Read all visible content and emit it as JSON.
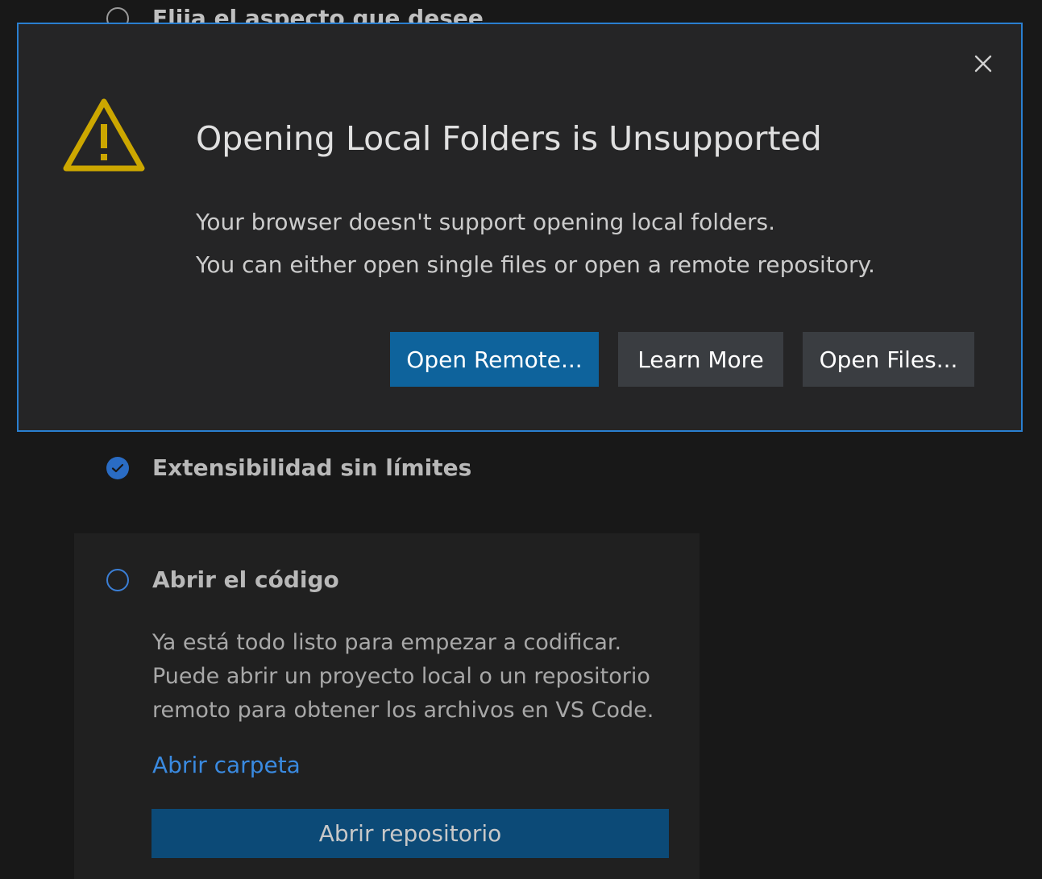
{
  "background": {
    "steps": {
      "appearance": {
        "title": "Elija el aspecto que desee"
      },
      "extensibility": {
        "title": "Extensibilidad sin límites"
      },
      "open_code": {
        "title": "Abrir el código",
        "description_lines": [
          "Ya está todo listo para empezar a codificar.",
          "Puede abrir un proyecto local o un repositorio",
          "remoto para obtener los archivos en VS Code."
        ],
        "link_label": "Abrir carpeta",
        "button_label": "Abrir repositorio"
      }
    }
  },
  "dialog": {
    "icon": "warning-icon",
    "title": "Opening Local Folders is Unsupported",
    "message_lines": [
      "Your browser doesn't support opening local folders.",
      "You can either open single files or open a remote repository."
    ],
    "buttons": {
      "open_remote": "Open Remote...",
      "learn_more": "Learn More",
      "open_files": "Open Files..."
    },
    "close_icon": "close-icon"
  },
  "colors": {
    "accent": "#0e639c",
    "warning": "#cca700",
    "dialog_border": "#2a7fd0",
    "link": "#3a8ae0"
  }
}
